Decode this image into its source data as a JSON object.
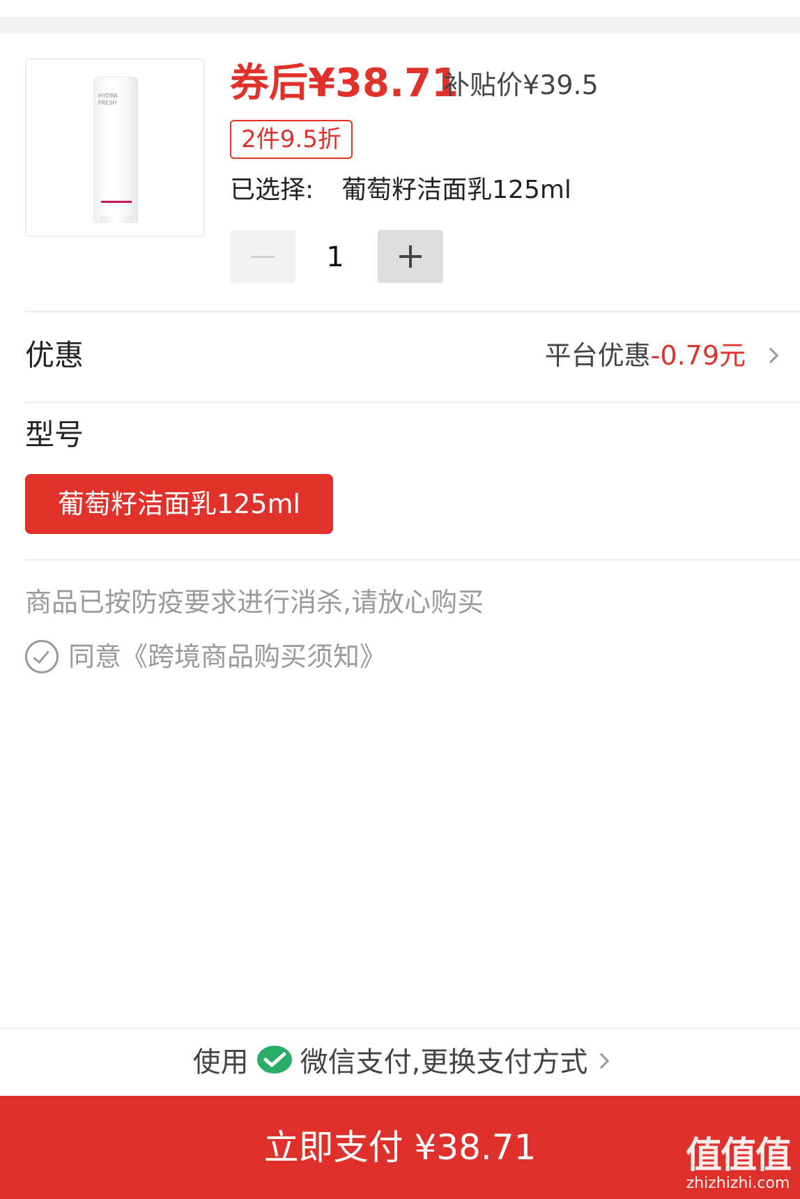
{
  "product": {
    "image_text": "HYDRA FRESH",
    "price_after_coupon": "券后¥38.71",
    "subsidy_price": "补贴价¥39.5",
    "discount_tag": "2件9.5折",
    "selected_label": "已选择:",
    "selected_value": "葡萄籽洁面乳125ml",
    "quantity": "1"
  },
  "promotion": {
    "label": "优惠",
    "platform_label": "平台优惠",
    "platform_amount": "-0.79元"
  },
  "model": {
    "label": "型号",
    "options": [
      "葡萄籽洁面乳125ml"
    ],
    "selected_index": 0
  },
  "notice": "商品已按防疫要求进行消杀,请放心购买",
  "agreement": "同意《跨境商品购买须知》",
  "payment": {
    "prefix": "使用",
    "method": "微信支付,更换支付方式",
    "icon": "wechat-pay-icon"
  },
  "pay_button": "立即支付 ¥38.71",
  "watermark": {
    "logo": "值值值",
    "site": "zhizhizhi.com"
  },
  "colors": {
    "accent": "#e0312a",
    "wechat_green": "#2aae67"
  }
}
